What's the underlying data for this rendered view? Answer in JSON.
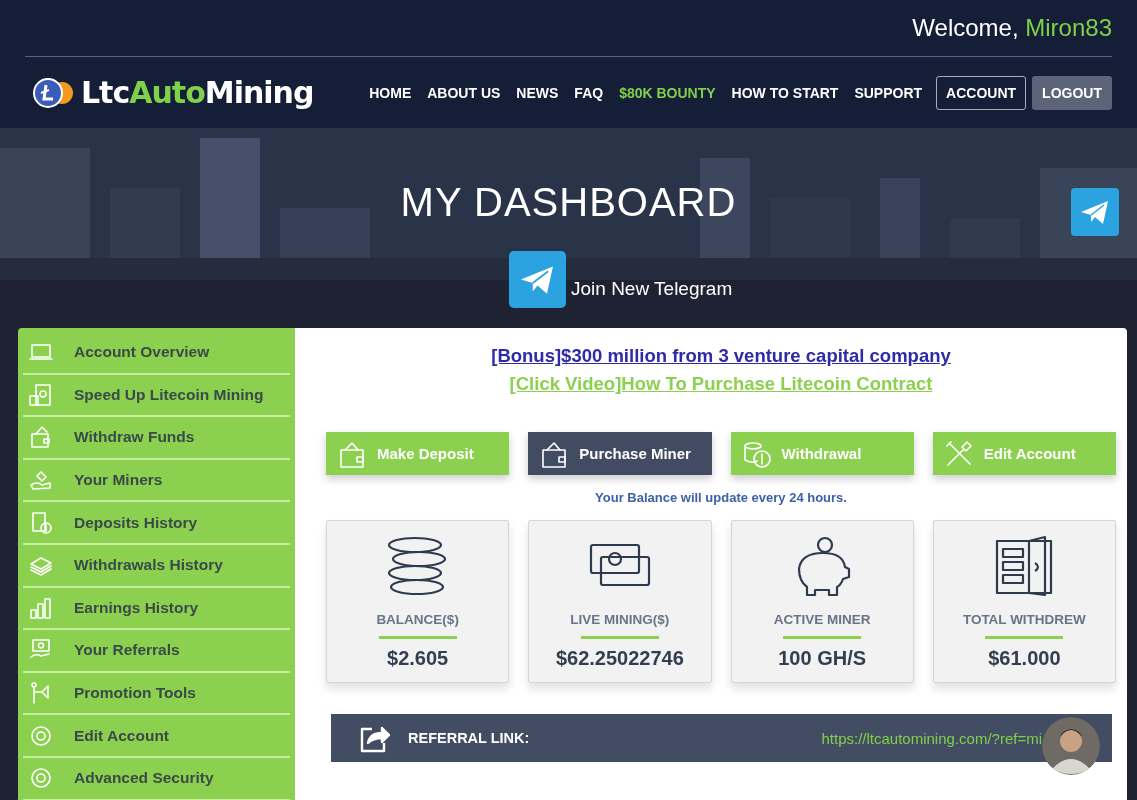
{
  "header": {
    "welcome": "Welcome,",
    "username": "Miron83"
  },
  "logo": {
    "part_1": "Ltc",
    "part_2": "Auto",
    "part_3": "Mining"
  },
  "nav": [
    {
      "label": "HOME",
      "kind": "link"
    },
    {
      "label": "ABOUT US",
      "kind": "link"
    },
    {
      "label": "NEWS",
      "kind": "link"
    },
    {
      "label": "FAQ",
      "kind": "link"
    },
    {
      "label": "$80K BOUNTY",
      "kind": "highlight"
    },
    {
      "label": "HOW TO START",
      "kind": "link"
    },
    {
      "label": "SUPPORT",
      "kind": "link"
    },
    {
      "label": "ACCOUNT",
      "kind": "outline"
    },
    {
      "label": "LOGOUT",
      "kind": "filled"
    }
  ],
  "hero": {
    "title": "MY DASHBOARD",
    "telegram_label": "Join New Telegram"
  },
  "sidebar": {
    "items": [
      {
        "label": "Account Overview"
      },
      {
        "label": "Speed Up Litecoin Mining"
      },
      {
        "label": "Withdraw Funds"
      },
      {
        "label": "Your Miners"
      },
      {
        "label": "Deposits History"
      },
      {
        "label": "Withdrawals History"
      },
      {
        "label": "Earnings History"
      },
      {
        "label": "Your Referrals"
      },
      {
        "label": "Promotion Tools"
      },
      {
        "label": "Edit Account"
      },
      {
        "label": "Advanced Security"
      }
    ]
  },
  "announcements": [
    {
      "text": "[Bonus]$300 million from 3 venture capital company",
      "kind": "primary"
    },
    {
      "text": "[Click Video]How To Purchase Litecoin Contract",
      "kind": "secondary"
    }
  ],
  "actions": [
    {
      "label": "Make Deposit",
      "selected": false
    },
    {
      "label": "Purchase Miner",
      "selected": true
    },
    {
      "label": "Withdrawal",
      "selected": false
    },
    {
      "label": "Edit Account",
      "selected": false
    }
  ],
  "balance_note": "Your Balance will update every 24 hours.",
  "stats": [
    {
      "label": "BALANCE($)",
      "value": "$2.605"
    },
    {
      "label": "LIVE MINING($)",
      "value": "$62.25022746"
    },
    {
      "label": "ACTIVE MINER",
      "value": "100 GH/S"
    },
    {
      "label": "TOTAL WITHDREW",
      "value": "$61.000"
    }
  ],
  "referral": {
    "label": "REFERRAL LINK:",
    "link": "https://ltcautomining.com/?ref=mi"
  }
}
